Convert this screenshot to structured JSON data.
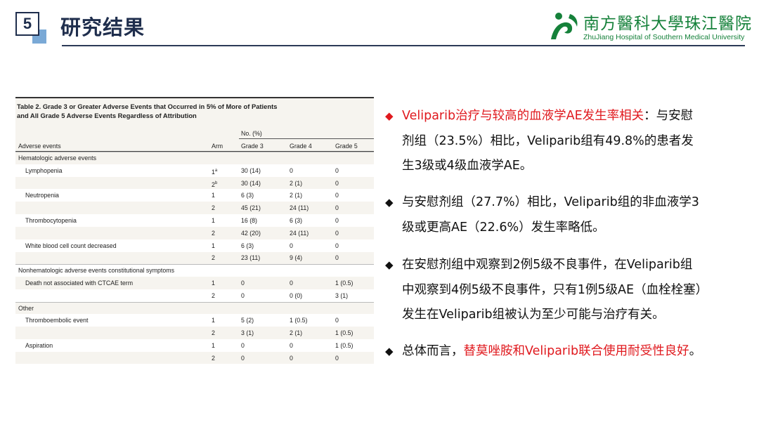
{
  "header": {
    "section_number": "5",
    "title": "研究结果",
    "logo_cn": "南方醫科大學珠江醫院",
    "logo_en": "ZhuJiang Hospital  of Southern Medical University",
    "colors": {
      "navy": "#1f2e4d",
      "accent_blue": "#7aa9d6",
      "logo_green": "#15813a",
      "highlight_red": "#e0191e"
    }
  },
  "table": {
    "caption_line1": "Table 2. Grade 3 or Greater Adverse Events that Occurred in 5% of More of Patients",
    "caption_line2": "and All Grade 5 Adverse Events Regardless of Attribution",
    "col_group": "No. (%)",
    "columns": [
      "Adverse events",
      "Arm",
      "Grade 3",
      "Grade 4",
      "Grade 5"
    ],
    "rows": [
      {
        "type": "group",
        "label": "Hematologic adverse events"
      },
      {
        "type": "data",
        "event": "Lymphopenia",
        "arm": "1",
        "sup": "a",
        "g3": "30 (14)",
        "g4": "0",
        "g5": "0"
      },
      {
        "type": "data",
        "event": "",
        "arm": "2",
        "sup": "b",
        "g3": "30 (14)",
        "g4": "2 (1)",
        "g5": "0"
      },
      {
        "type": "data",
        "event": "Neutropenia",
        "arm": "1",
        "sup": "",
        "g3": "6 (3)",
        "g4": "2 (1)",
        "g5": "0"
      },
      {
        "type": "data",
        "event": "",
        "arm": "2",
        "sup": "",
        "g3": "45 (21)",
        "g4": "24 (11)",
        "g5": "0"
      },
      {
        "type": "data",
        "event": "Thrombocytopenia",
        "arm": "1",
        "sup": "",
        "g3": "16 (8)",
        "g4": "6 (3)",
        "g5": "0"
      },
      {
        "type": "data",
        "event": "",
        "arm": "2",
        "sup": "",
        "g3": "42 (20)",
        "g4": "24 (11)",
        "g5": "0"
      },
      {
        "type": "data",
        "event": "White blood cell count decreased",
        "arm": "1",
        "sup": "",
        "g3": "6 (3)",
        "g4": "0",
        "g5": "0"
      },
      {
        "type": "data",
        "event": "",
        "arm": "2",
        "sup": "",
        "g3": "23 (11)",
        "g4": "9 (4)",
        "g5": "0"
      },
      {
        "type": "group",
        "label": "Nonhematologic adverse events constitutional symptoms"
      },
      {
        "type": "data",
        "event": "Death not associated with CTCAE term",
        "arm": "1",
        "sup": "",
        "g3": "0",
        "g4": "0",
        "g5": "1 (0.5)"
      },
      {
        "type": "data",
        "event": "",
        "arm": "2",
        "sup": "",
        "g3": "0",
        "g4": "0 (0)",
        "g5": "3 (1)"
      },
      {
        "type": "group",
        "label": "Other"
      },
      {
        "type": "data",
        "event": "Thromboembolic event",
        "arm": "1",
        "sup": "",
        "g3": "5 (2)",
        "g4": "1 (0.5)",
        "g5": "0"
      },
      {
        "type": "data",
        "event": "",
        "arm": "2",
        "sup": "",
        "g3": "3 (1)",
        "g4": "2 (1)",
        "g5": "1 (0.5)"
      },
      {
        "type": "data",
        "event": "Aspiration",
        "arm": "1",
        "sup": "",
        "g3": "0",
        "g4": "0",
        "g5": "1 (0.5)"
      },
      {
        "type": "data",
        "event": "",
        "arm": "2",
        "sup": "",
        "g3": "0",
        "g4": "0",
        "g5": "0"
      }
    ]
  },
  "bullets": [
    {
      "marker": "◆",
      "lines": [
        [
          {
            "t": "Veliparib治疗与较高的血液学AE发生率相关",
            "red": true
          },
          {
            "t": "：与安慰",
            "red": false
          }
        ],
        [
          {
            "t": "剂组（23.5%）相比，Veliparib组有49.8%的患者发",
            "red": false
          }
        ],
        [
          {
            "t": "生3级或4级血液学AE。",
            "red": false
          }
        ]
      ],
      "red_marker": true
    },
    {
      "marker": "◆",
      "lines": [
        [
          {
            "t": "与安慰剂组（27.7%）相比，Veliparib组的非血液学3",
            "red": false
          }
        ],
        [
          {
            "t": "级或更高AE（22.6%）发生率略低。",
            "red": false
          }
        ]
      ],
      "red_marker": false
    },
    {
      "marker": "◆",
      "lines": [
        [
          {
            "t": "在安慰剂组中观察到2例5级不良事件，在Veliparib组",
            "red": false
          }
        ],
        [
          {
            "t": "中观察到4例5级不良事件，只有1例5级AE（血栓栓塞）",
            "red": false
          }
        ],
        [
          {
            "t": "发生在Veliparib组被认为至少可能与治疗有关。",
            "red": false
          }
        ]
      ],
      "red_marker": false
    },
    {
      "marker": "◆",
      "lines": [
        [
          {
            "t": "总体而言，",
            "red": false
          },
          {
            "t": "替莫唑胺和Veliparib联合使用耐受性良好",
            "red": true
          },
          {
            "t": "。",
            "red": false
          }
        ]
      ],
      "red_marker": false
    }
  ]
}
